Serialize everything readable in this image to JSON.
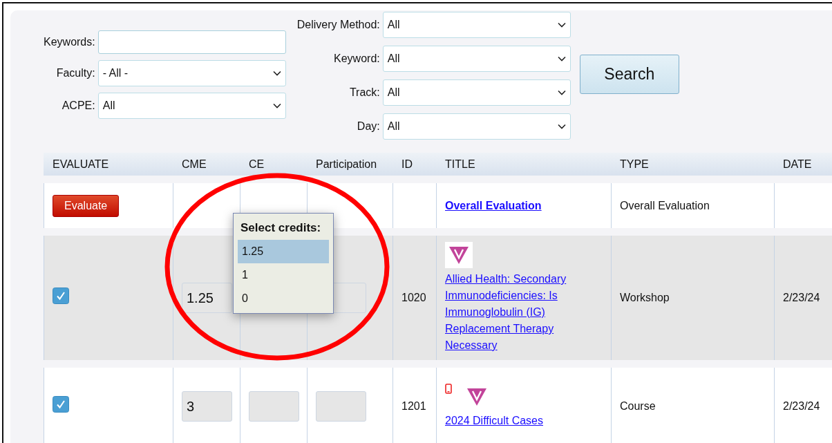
{
  "filters": {
    "left": [
      {
        "label": "Keywords:",
        "kind": "text"
      },
      {
        "label": "Faculty:",
        "kind": "select",
        "value": "- All -"
      },
      {
        "label": "ACPE:",
        "kind": "select",
        "value": "All"
      }
    ],
    "right": [
      {
        "label": "Delivery Method:",
        "kind": "select",
        "value": "All"
      },
      {
        "label": "Keyword:",
        "kind": "select",
        "value": "All"
      },
      {
        "label": "Track:",
        "kind": "select",
        "value": "All"
      },
      {
        "label": "Day:",
        "kind": "select",
        "value": "All"
      }
    ],
    "search_button": "Search"
  },
  "table": {
    "columns": [
      "EVALUATE",
      "CME",
      "CE",
      "Participation",
      "ID",
      "TITLE",
      "TYPE",
      "DATE"
    ],
    "rows": [
      {
        "shaded": false,
        "evaluate": {
          "kind": "button",
          "label": "Evaluate"
        },
        "title": "Overall Evaluation",
        "title_bold": true,
        "type": "Overall Evaluation"
      },
      {
        "shaded": true,
        "evaluate": {
          "kind": "checkbox",
          "checked": true
        },
        "credit_fields": [
          {
            "kind": "input",
            "value": "1.25"
          },
          {
            "kind": "covered"
          },
          {
            "kind": "input"
          }
        ],
        "id": "1020",
        "title_icons": [
          {
            "kind": "v-logo"
          }
        ],
        "title": "Allied Health: Secondary Immunodeficiencies: Is Immunoglobulin (IG) Replacement Therapy Necessary",
        "title_bold": false,
        "type": "Workshop",
        "date": "2/23/24"
      },
      {
        "shaded": false,
        "evaluate": {
          "kind": "checkbox",
          "checked": true
        },
        "credit_fields": [
          {
            "kind": "input",
            "value": "3"
          },
          {
            "kind": "input"
          },
          {
            "kind": "input"
          }
        ],
        "id": "1201",
        "title_icons": [
          {
            "kind": "phone"
          },
          {
            "kind": "v-logo"
          }
        ],
        "title": "2024 Difficult Cases",
        "title_bold": false,
        "type": "Course",
        "date": "2/23/24"
      }
    ]
  },
  "credits_popup": {
    "title": "Select credits:",
    "options": [
      {
        "label": "1.25",
        "selected": true
      },
      {
        "label": "1",
        "selected": false
      },
      {
        "label": "0",
        "selected": false
      }
    ]
  }
}
